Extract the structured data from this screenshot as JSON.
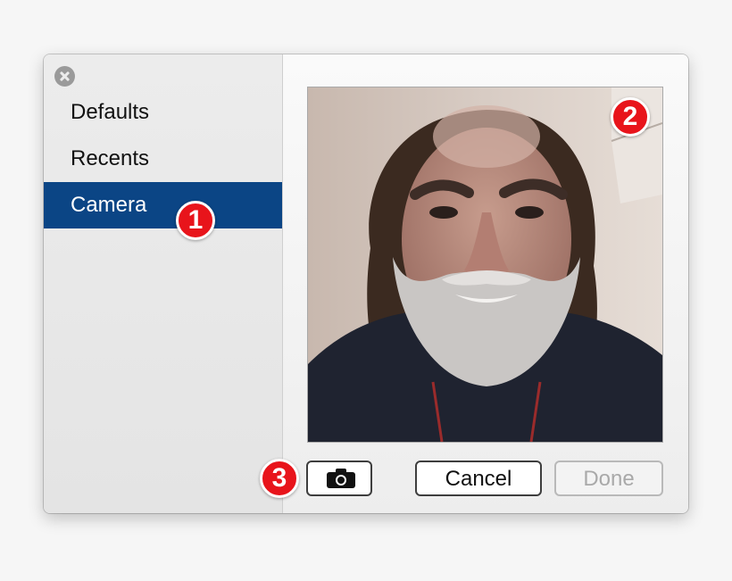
{
  "sidebar": {
    "items": [
      {
        "label": "Defaults"
      },
      {
        "label": "Recents"
      },
      {
        "label": "Camera",
        "selected": true
      }
    ]
  },
  "buttons": {
    "cancel_label": "Cancel",
    "done_label": "Done",
    "camera_icon": "camera-icon"
  },
  "annotations": {
    "badge_1": "1",
    "badge_2": "2",
    "badge_3": "3"
  },
  "colors": {
    "selection": "#0b4585",
    "badge": "#e8141b"
  }
}
